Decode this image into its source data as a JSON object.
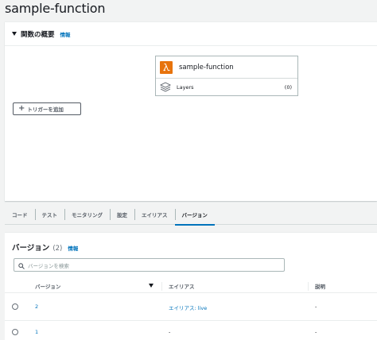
{
  "page": {
    "title": "sample-function"
  },
  "overview": {
    "title": "関数の概要",
    "info": "情報",
    "function_name": "sample-function",
    "layers_label": "Layers",
    "layers_count": "(0)",
    "add_trigger_label": "トリガーを追加"
  },
  "tabs": [
    {
      "label": "コード"
    },
    {
      "label": "テスト"
    },
    {
      "label": "モニタリング"
    },
    {
      "label": "設定"
    },
    {
      "label": "エイリアス"
    },
    {
      "label": "バージョン",
      "active": true
    }
  ],
  "versions": {
    "title": "バージョン",
    "count": "(2)",
    "info": "情報",
    "search_placeholder": "バージョンを検索",
    "columns": [
      "バージョン",
      "エイリアス",
      "説明"
    ],
    "rows": [
      {
        "version": "2",
        "alias": "エイリアス: live",
        "description": "-"
      },
      {
        "version": "1",
        "alias": "-",
        "description": "-"
      }
    ]
  },
  "colors": {
    "accent": "#0073bb",
    "lambda_orange": "#e7730c"
  },
  "icons": [
    "caret-down-icon",
    "lambda-icon",
    "layers-icon",
    "plus-icon",
    "search-icon",
    "sort-down-icon",
    "radio-icon"
  ]
}
